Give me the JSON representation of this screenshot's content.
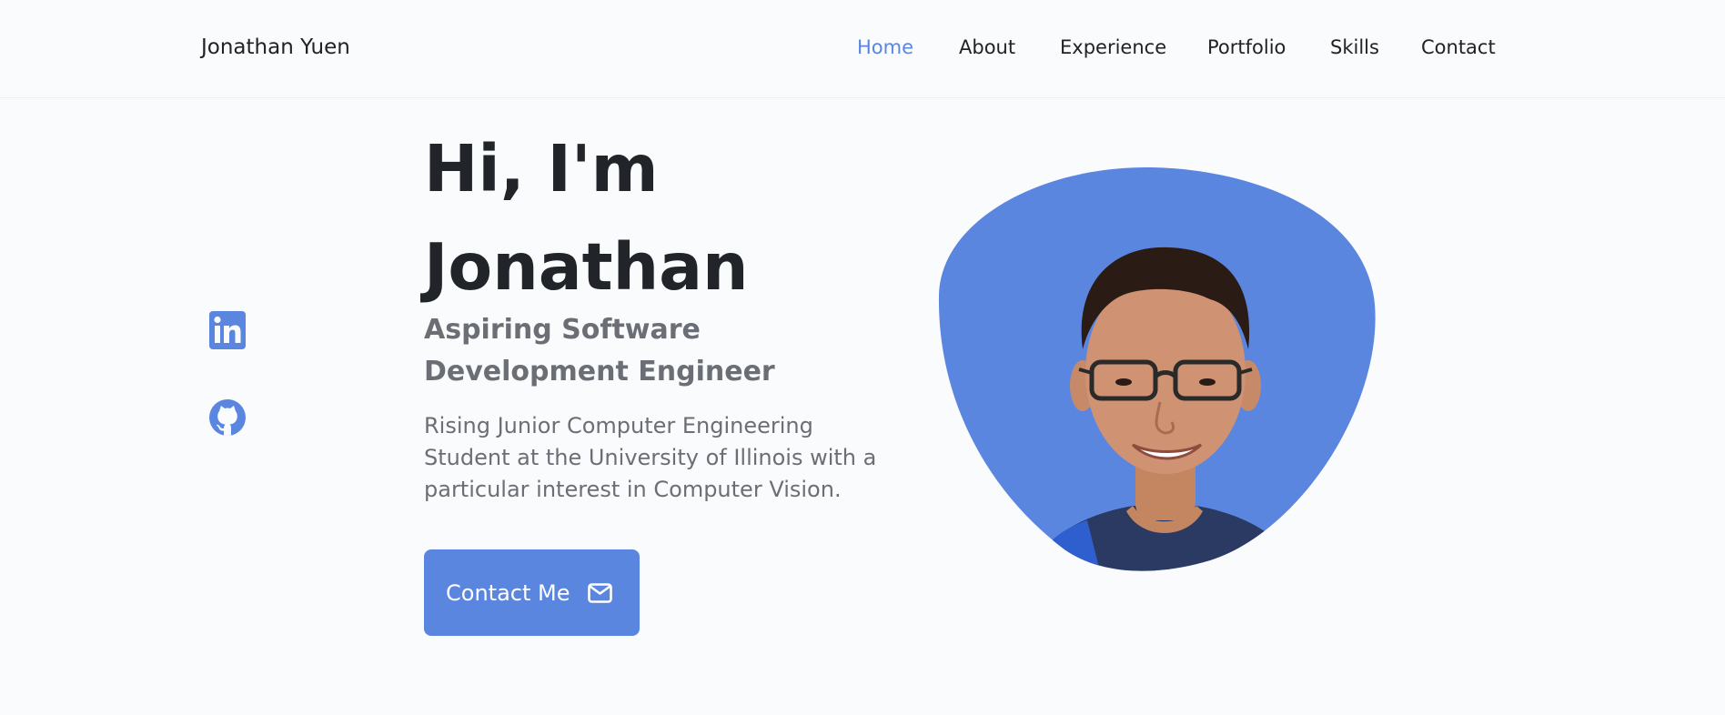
{
  "header": {
    "brand": "Jonathan Yuen",
    "nav": [
      {
        "label": "Home",
        "active": true
      },
      {
        "label": "About",
        "active": false
      },
      {
        "label": "Experience",
        "active": false
      },
      {
        "label": "Portfolio",
        "active": false
      },
      {
        "label": "Skills",
        "active": false
      },
      {
        "label": "Contact",
        "active": false
      }
    ]
  },
  "social": [
    {
      "icon": "linkedin-icon"
    },
    {
      "icon": "github-icon"
    }
  ],
  "hero": {
    "title_line1": "Hi, I'm",
    "title_line2": "Jonathan",
    "subtitle": "Aspiring Software Development Engineer",
    "description": "Rising Junior Computer Engineering Student at the University of Illinois with a particular interest in Computer Vision.",
    "cta_label": "Contact Me",
    "cta_icon": "mail-icon"
  },
  "colors": {
    "accent": "#5b86e0",
    "text": "#222222",
    "muted": "#6b6e75",
    "background": "#f9fbfd"
  }
}
